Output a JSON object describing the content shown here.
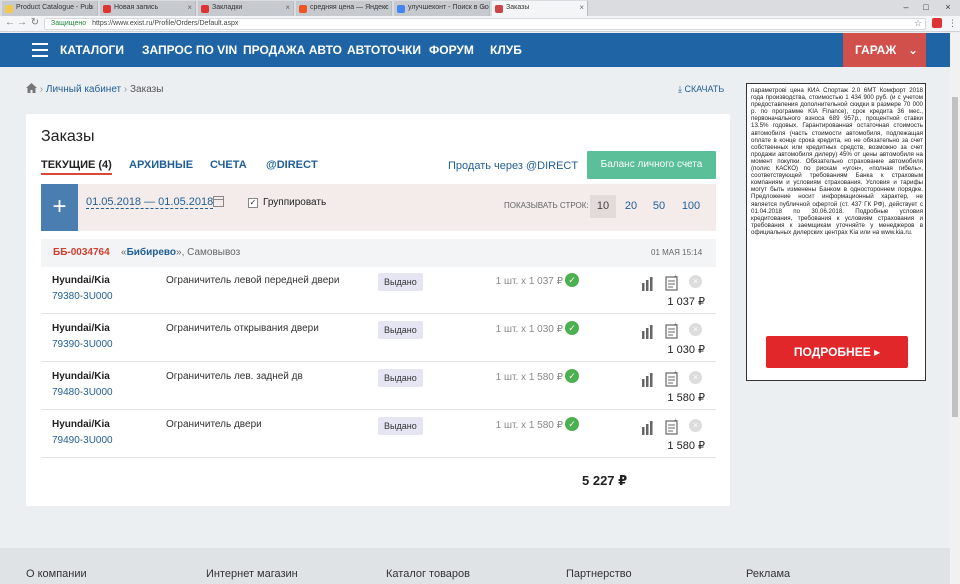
{
  "browser": {
    "tabs": [
      {
        "label": "Product Catalogue - Pub",
        "fav": "#f2c94c"
      },
      {
        "label": "Новая запись",
        "fav": "#d33"
      },
      {
        "label": "Закладки",
        "fav": "#d33"
      },
      {
        "label": "средняя цена — Яндекс",
        "fav": "#e52"
      },
      {
        "label": "улучшеконт - Поиск в Go",
        "fav": "#4285f4"
      },
      {
        "label": "Заказы",
        "fav": "#c44"
      }
    ],
    "secure_label": "Защищено",
    "url": "https://www.exist.ru/Profile/Orders/Default.aspx"
  },
  "nav": {
    "items": [
      "КАТАЛОГИ",
      "ЗАПРОС ПО VIN",
      "ПРОДАЖА АВТО",
      "АВТОТОЧКИ",
      "ФОРУМ",
      "КЛУБ"
    ],
    "garage": "ГАРАЖ"
  },
  "breadcrumb": {
    "link": "Личный кабинет",
    "current": "Заказы"
  },
  "download_label": "СКАЧАТЬ",
  "orders": {
    "title": "Заказы",
    "tabs": [
      "ТЕКУЩИЕ (4)",
      "АРХИВНЫЕ",
      "СЧЕТА",
      "@DIRECT"
    ],
    "sell_link": "Продать через @DIRECT",
    "balance_button": "Баланс личного счета",
    "filter": {
      "date_range": "01.05.2018 — 01.05.2018",
      "group_label": "Группировать",
      "group_checked_mark": "✓",
      "show_rows_label": "ПОКАЗЫВАТЬ СТРОК:",
      "row_options": [
        "10",
        "20",
        "50",
        "100"
      ]
    },
    "order": {
      "number": "ББ-0034764",
      "open_quote": "«",
      "location_link": "Бибирево",
      "location_rest": "», Самовывоз",
      "date": "01 МАЯ 15:14"
    },
    "items": [
      {
        "brand": "Hyundai/Kia",
        "part_number": "79380-3U000",
        "description": "Ограничитель левой передней двери",
        "status": "Выдано",
        "qty": "1 шт. х 1 037 ₽",
        "price": "1 037 ₽"
      },
      {
        "brand": "Hyundai/Kia",
        "part_number": "79390-3U000",
        "description": "Ограничитель открывания двери",
        "status": "Выдано",
        "qty": "1 шт. х 1 030 ₽",
        "price": "1 030 ₽"
      },
      {
        "brand": "Hyundai/Kia",
        "part_number": "79480-3U000",
        "description": "Ограничитель лев. задней дв",
        "status": "Выдано",
        "qty": "1 шт. х 1 580 ₽",
        "price": "1 580 ₽"
      },
      {
        "brand": "Hyundai/Kia",
        "part_number": "79490-3U000",
        "description": "Ограничитель двери",
        "status": "Выдано",
        "qty": "1 шт. х 1 580 ₽",
        "price": "1 580 ₽"
      }
    ],
    "total": "5 227 ₽"
  },
  "ad": {
    "text": "параметрові цена КИА Спортаж 2.0 6МТ Комфорт 2018 года производства, стоимостью 1 434 900 руб. (и с учетом предоставления дополнительной скидки в размере 70 000 р. по программе KIA Finance), срок кредита 36 мес., первоначального взноса 689 957р., процентной ставки 13.5% годовых. Гарантированная остаточная стоимость автомобиля (часть стоимости автомобиля, подлежащая оплате в конце срока кредита, но не обязательно за счет собственных или кредитных средств, возможно за счет продажи автомобиля дилеру) 45% от цены автомобиля на момент покупки. Обязательно страхование автомобиля (полис КАСКО) по рискам «угон», «полная гибель», соответствующей требованиям Банка к страховым компаниям и условиям страхования. Условия и тарифы могут быть изменены Банком в одностороннем порядке. Предложение носит информационный характер, не является публичной офертой (ст. 437 ГК РФ), действует с 01.04.2018 по 30.06.2018. Подробные условия кредитования, требования к условиям страхования и требования к заемщикам уточняйте у менеджеров в официальных дилерских центрах Kia или на www.kia.ru.",
    "button": "ПОДРОБНЕЕ ▸"
  },
  "footer": [
    "О компании",
    "Интернет магазин",
    "Каталог товаров",
    "Партнерство",
    "Реклама"
  ],
  "colors": {
    "nav_bg": "#1f65a5",
    "garage_bg": "#d1504b",
    "accent_link": "#1f5e96",
    "balance_bg": "#5bbf9a",
    "order_number": "#d13d2f",
    "ad_button": "#e2272b"
  }
}
